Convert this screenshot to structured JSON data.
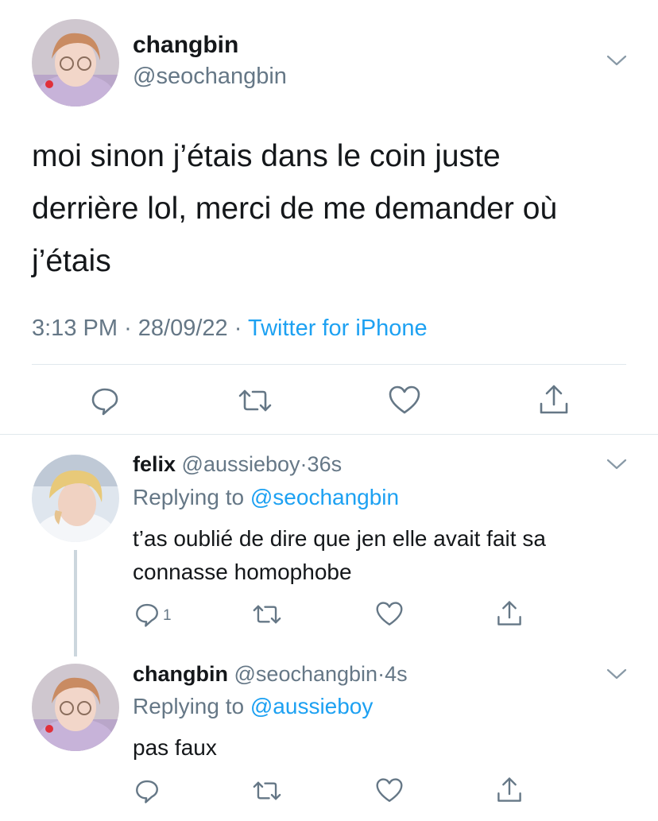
{
  "main_tweet": {
    "display_name": "changbin",
    "handle": "@seochangbin",
    "text_lines": [
      "moi sinon j’étais dans le coin juste",
      "derrière lol, merci de me demander où",
      "j’étais"
    ],
    "time": "3:13 PM",
    "date": "28/09/22",
    "separator": "·",
    "source": "Twitter for iPhone"
  },
  "replies": [
    {
      "display_name": "felix",
      "handle": "@aussieboy",
      "separator": "·",
      "time_ago": "36s",
      "replying_prefix": "Replying to",
      "replying_to": "@seochangbin",
      "text_lines": [
        "t’as oublié de dire que jen elle avait fait sa",
        "connasse homophobe"
      ],
      "reply_count": "1"
    },
    {
      "display_name": "changbin",
      "handle": "@seochangbin",
      "separator": "·",
      "time_ago": "4s",
      "replying_prefix": "Replying to",
      "replying_to": "@aussieboy",
      "text_lines": [
        "pas faux"
      ],
      "reply_count": ""
    }
  ],
  "icons": {
    "reply": "reply-icon",
    "retweet": "retweet-icon",
    "like": "heart-icon",
    "share": "share-icon",
    "more": "chevron-down-icon"
  },
  "colors": {
    "accent": "#1da1f2",
    "secondary_text": "#657786",
    "primary_text": "#14171a",
    "divider": "#e1e8ed"
  }
}
